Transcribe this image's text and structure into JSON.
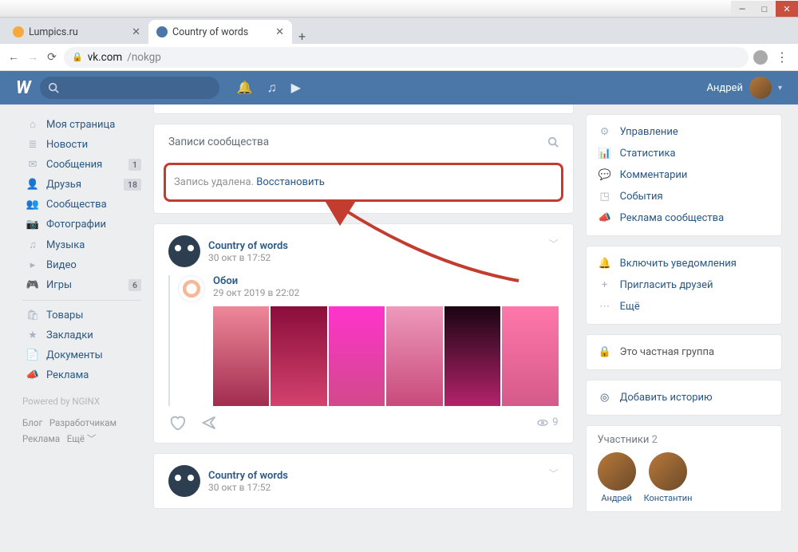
{
  "os": {
    "min": "—",
    "max": "□",
    "close": "✕"
  },
  "tabs": {
    "lumpics": "Lumpics.ru",
    "vk": "Country of words",
    "close": "✕",
    "new": "+"
  },
  "addr": {
    "back": "←",
    "fwd": "→",
    "reload": "⟳",
    "host": "vk.com",
    "path": "/nokgp"
  },
  "vk_header": {
    "user": "Андрей"
  },
  "leftnav": {
    "items": [
      {
        "label": "Моя страница",
        "icon": "⌂"
      },
      {
        "label": "Новости",
        "icon": "≣"
      },
      {
        "label": "Сообщения",
        "icon": "✉",
        "badge": "1"
      },
      {
        "label": "Друзья",
        "icon": "👤",
        "badge": "18"
      },
      {
        "label": "Сообщества",
        "icon": "👥"
      },
      {
        "label": "Фотографии",
        "icon": "📷"
      },
      {
        "label": "Музыка",
        "icon": "♫"
      },
      {
        "label": "Видео",
        "icon": "▸"
      },
      {
        "label": "Игры",
        "icon": "🎮",
        "badge": "6"
      }
    ],
    "items2": [
      {
        "label": "Товары",
        "icon": "🛍"
      },
      {
        "label": "Закладки",
        "icon": "★"
      },
      {
        "label": "Документы",
        "icon": "📄"
      },
      {
        "label": "Реклама",
        "icon": "📣"
      }
    ],
    "powered": "Powered by NGINX",
    "foot": [
      "Блог",
      "Разработчикам",
      "Реклама",
      "Ещё ﹀"
    ]
  },
  "wall": {
    "title": "Записи сообщества",
    "deleted_text": "Запись удалена. ",
    "restore": "Восстановить",
    "post1": {
      "name": "Country of words",
      "date": "30 окт в 17:52",
      "repost_name": "Обои",
      "repost_date": "29 окт 2019 в 22:02",
      "views": "9"
    },
    "post2": {
      "name": "Country of words",
      "date": "30 окт в 17:52"
    }
  },
  "right": {
    "manage": [
      {
        "label": "Управление",
        "icon": "⚙"
      },
      {
        "label": "Статистика",
        "icon": "📊"
      },
      {
        "label": "Комментарии",
        "icon": "💬"
      },
      {
        "label": "События",
        "icon": "◳"
      },
      {
        "label": "Реклама сообщества",
        "icon": "📣"
      }
    ],
    "actions": [
      {
        "label": "Включить уведомления",
        "icon": "🔔"
      },
      {
        "label": "Пригласить друзей",
        "icon": "+"
      },
      {
        "label": "Ещё",
        "icon": "⋯"
      }
    ],
    "private": "Это частная группа",
    "story": "Добавить историю",
    "members_title": "Участники",
    "members_count": "2",
    "members": [
      "Андрей",
      "Константин"
    ]
  }
}
